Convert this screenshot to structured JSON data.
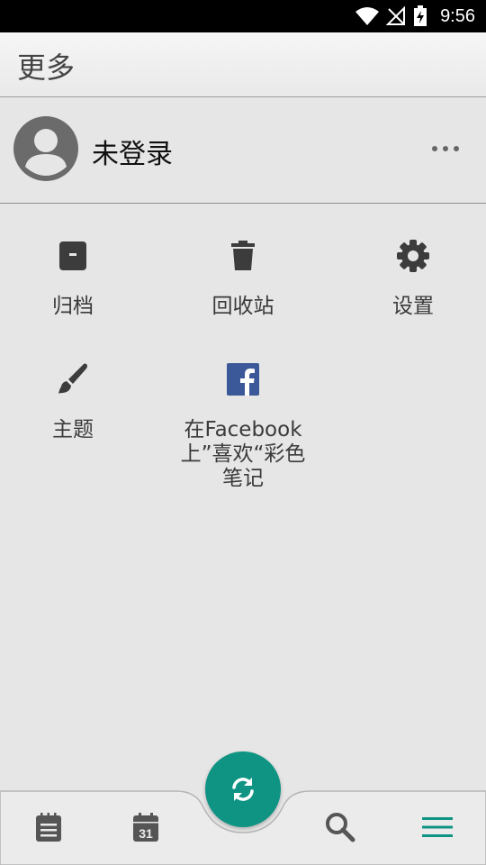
{
  "status": {
    "time": "9:56"
  },
  "appbar": {
    "title": "更多"
  },
  "account": {
    "name": "未登录"
  },
  "menu": {
    "archive": "归档",
    "trash": "回收站",
    "settings": "设置",
    "theme": "主题",
    "facebook": "在Facebook\n上”喜欢“彩色\n笔记"
  },
  "bottom_nav": {
    "active": "menu",
    "accent": "#0f9484",
    "icons": [
      "notes-icon",
      "calendar-icon",
      "sync-icon",
      "search-icon",
      "menu-icon"
    ],
    "calendar_day": "31"
  }
}
